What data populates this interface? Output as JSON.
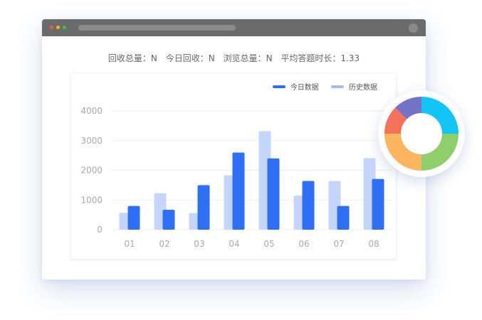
{
  "window": {
    "stats": [
      {
        "label": "回收总量：",
        "value": "N"
      },
      {
        "label": "今日回收：",
        "value": "N"
      },
      {
        "label": "浏览总量：",
        "value": "N"
      },
      {
        "label": "平均答题时长：",
        "value": "1.33"
      }
    ]
  },
  "colors": {
    "today": "#2e6ff3",
    "history": "#c4d6fb",
    "history_legend": "#9fbff8",
    "grid": "#eeeeee",
    "tick": "#aaaaaa"
  },
  "chart_data": {
    "type": "bar",
    "categories": [
      "01",
      "02",
      "03",
      "04",
      "05",
      "06",
      "07",
      "08"
    ],
    "series": [
      {
        "name": "历史数据",
        "values": [
          570,
          1230,
          560,
          1830,
          3320,
          1150,
          1640,
          2410
        ]
      },
      {
        "name": "今日数据",
        "values": [
          800,
          670,
          1500,
          2600,
          2400,
          1640,
          800,
          1710
        ]
      }
    ],
    "yticks": [
      0,
      1000,
      2000,
      3000,
      4000
    ],
    "ylim": [
      0,
      4000
    ],
    "grid": true,
    "legend_position": "top-right"
  },
  "donut": {
    "segments": [
      {
        "name": "cyan",
        "value": 25,
        "color": "#12c5f5"
      },
      {
        "name": "green",
        "value": 25,
        "color": "#8fcf6b"
      },
      {
        "name": "orange",
        "value": 25,
        "color": "#fbb55f"
      },
      {
        "name": "red",
        "value": 12.5,
        "color": "#f4725a"
      },
      {
        "name": "purple",
        "value": 12.5,
        "color": "#7272c6"
      }
    ]
  }
}
